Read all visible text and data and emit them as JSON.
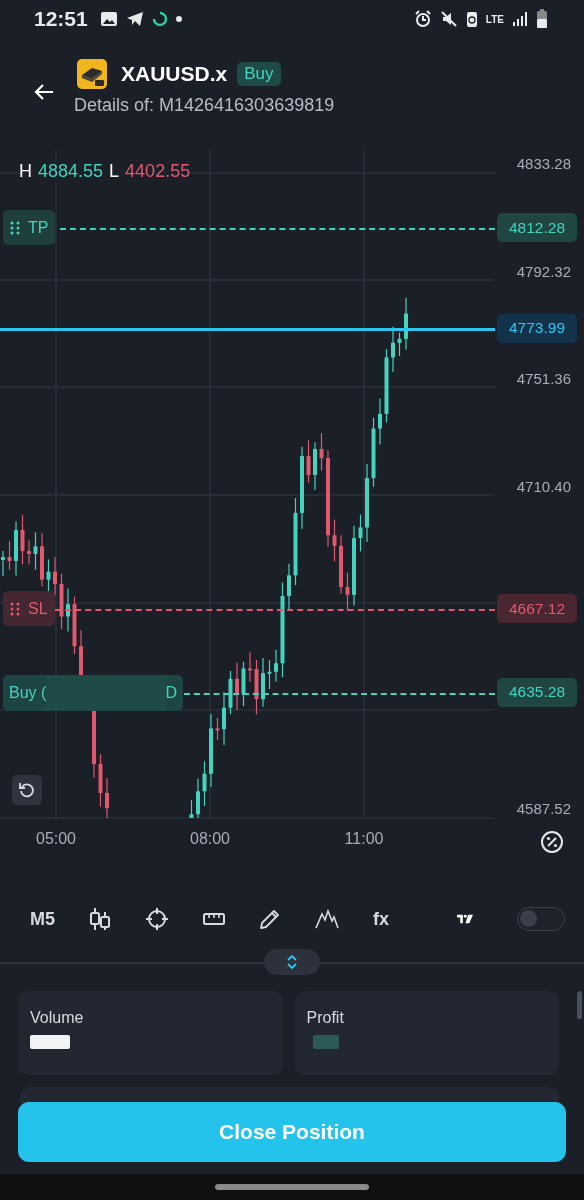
{
  "status_bar": {
    "time": "12:51",
    "network": "LTE"
  },
  "header": {
    "symbol": "XAUUSD.x",
    "side": "Buy",
    "subtitle": "Details of: M1426416303639819"
  },
  "chart": {
    "high_label": "H",
    "high": "4884.55",
    "low_label": "L",
    "low": "4402.55",
    "price_axis": [
      "4833.28",
      "4792.32",
      "4751.36",
      "4710.40",
      "4587.52"
    ],
    "time_axis": [
      "05:00",
      "08:00",
      "11:00"
    ],
    "lines": [
      {
        "kind": "tp",
        "label": "TP",
        "price": "4812.28"
      },
      {
        "kind": "current",
        "price": "4773.99"
      },
      {
        "kind": "sl",
        "label": "SL",
        "price": "4667.12"
      },
      {
        "kind": "entry",
        "label": "Buy (",
        "label_end": "D",
        "price": "4635.28"
      }
    ]
  },
  "toolbar": {
    "items": [
      {
        "kind": "text",
        "label": "M5"
      },
      {
        "kind": "candles"
      },
      {
        "kind": "crosshair"
      },
      {
        "kind": "ruler"
      },
      {
        "kind": "pencil"
      },
      {
        "kind": "indicator"
      },
      {
        "kind": "text",
        "label": "fx"
      }
    ],
    "toggle": {
      "on": false
    }
  },
  "cards": [
    {
      "label": "Volume"
    },
    {
      "label": "Profit"
    }
  ],
  "close_button": "Close Position"
}
